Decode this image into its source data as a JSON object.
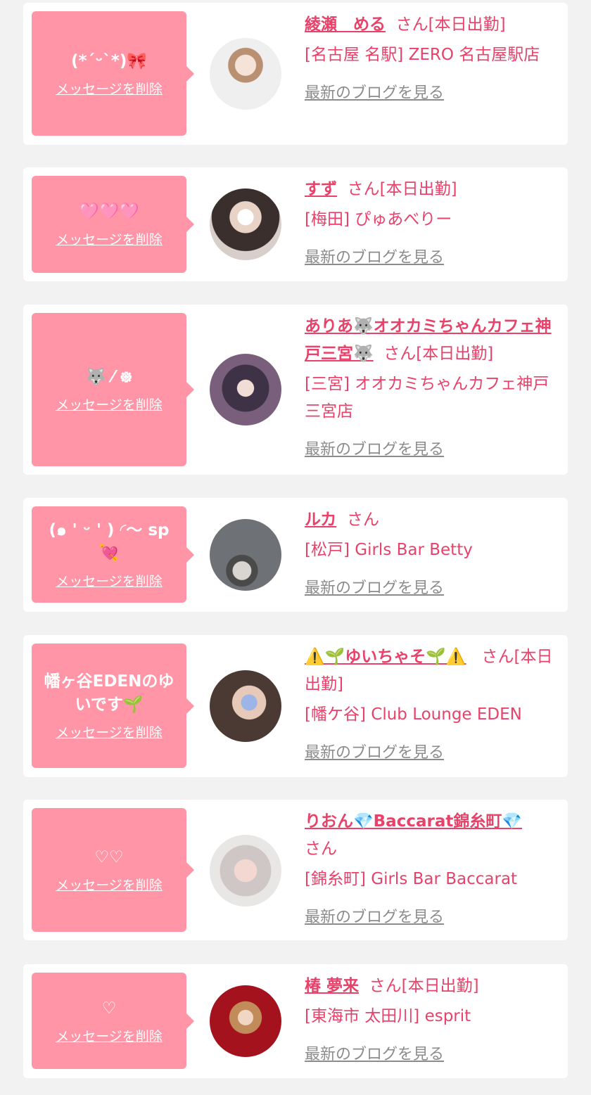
{
  "colors": {
    "page_bg": "#f2f2f2",
    "card_bg": "#ffffff",
    "bubble_bg": "#ff95a6",
    "accent_pink": "#e8426a",
    "link_gray": "#8c8c8c"
  },
  "entries": [
    {
      "message": "(*´ᵕ`*)🎀",
      "delete_label": "メッセージを削除",
      "name": "綾瀬　める",
      "suffix": "さん[本日出勤]",
      "shop": "[名古屋 名駅] ZERO 名古屋駅店",
      "blog_link": "最新のブログを見る",
      "avatar": "profile-photo"
    },
    {
      "message": "🩷🩷🩷",
      "delete_label": "メッセージを削除",
      "name": "すず",
      "suffix": "さん[本日出勤]",
      "shop": "[梅田] ぴゅあべりー",
      "blog_link": "最新のブログを見る",
      "avatar": "profile-photo"
    },
    {
      "message": "🐺 ⁄ ᪥",
      "delete_label": "メッセージを削除",
      "name": "ありあ🐺オオカミちゃんカフェ神戸三宮🐺",
      "suffix": "さん[本日出勤]",
      "shop": "[三宮] オオカミちゃんカフェ神戸三宮店",
      "blog_link": "最新のブログを見る",
      "avatar": "profile-photo"
    },
    {
      "message": "(๑ ' ᵕ ' ) ◜〜 sp 💘",
      "delete_label": "メッセージを削除",
      "name": "ルカ",
      "suffix": "さん",
      "shop": "[松戸] Girls Bar Betty",
      "blog_link": "最新のブログを見る",
      "avatar": "profile-photo"
    },
    {
      "message": "幡ヶ谷EDENのゆいです🌱",
      "delete_label": "メッセージを削除",
      "name": "⚠️🌱ゆいちゃそ🌱⚠️",
      "suffix": "さん[本日出勤]",
      "shop": "[幡ケ谷] Club Lounge EDEN",
      "blog_link": "最新のブログを見る",
      "avatar": "profile-photo"
    },
    {
      "message": "♡♡",
      "delete_label": "メッセージを削除",
      "name": "りおん💎Baccarat錦糸町💎",
      "suffix": "さん",
      "shop": "[錦糸町] Girls Bar Baccarat",
      "blog_link": "最新のブログを見る",
      "avatar": "profile-photo"
    },
    {
      "message": "♡",
      "delete_label": "メッセージを削除",
      "name": "椿 夢来",
      "suffix": "さん[本日出勤]",
      "shop": "[東海市 太田川] esprit",
      "blog_link": "最新のブログを見る",
      "avatar": "profile-photo"
    }
  ]
}
